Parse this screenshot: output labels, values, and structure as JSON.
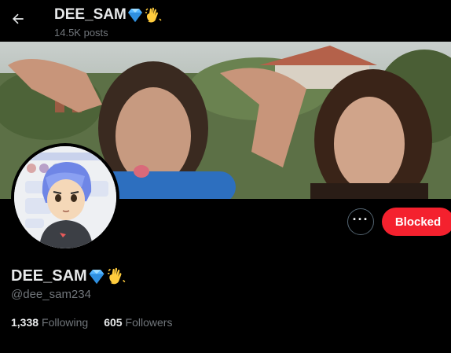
{
  "header": {
    "name": "DEE_SAM",
    "posts": "14.5K posts",
    "back_icon": "arrow-left-icon"
  },
  "profile": {
    "name": "DEE_SAM",
    "handle": "@dee_sam234",
    "name_emojis": [
      "gem-icon",
      "waving-hand-icon"
    ]
  },
  "actions": {
    "more_label": "···",
    "blocked_label": "Blocked"
  },
  "stats": {
    "following_count": "1,338",
    "following_label": "Following",
    "followers_count": "605",
    "followers_label": "Followers"
  },
  "colors": {
    "background": "#000000",
    "text_primary": "#e7e9ea",
    "text_secondary": "#71767b",
    "blocked_red": "#f4212e",
    "button_border": "#536471"
  }
}
